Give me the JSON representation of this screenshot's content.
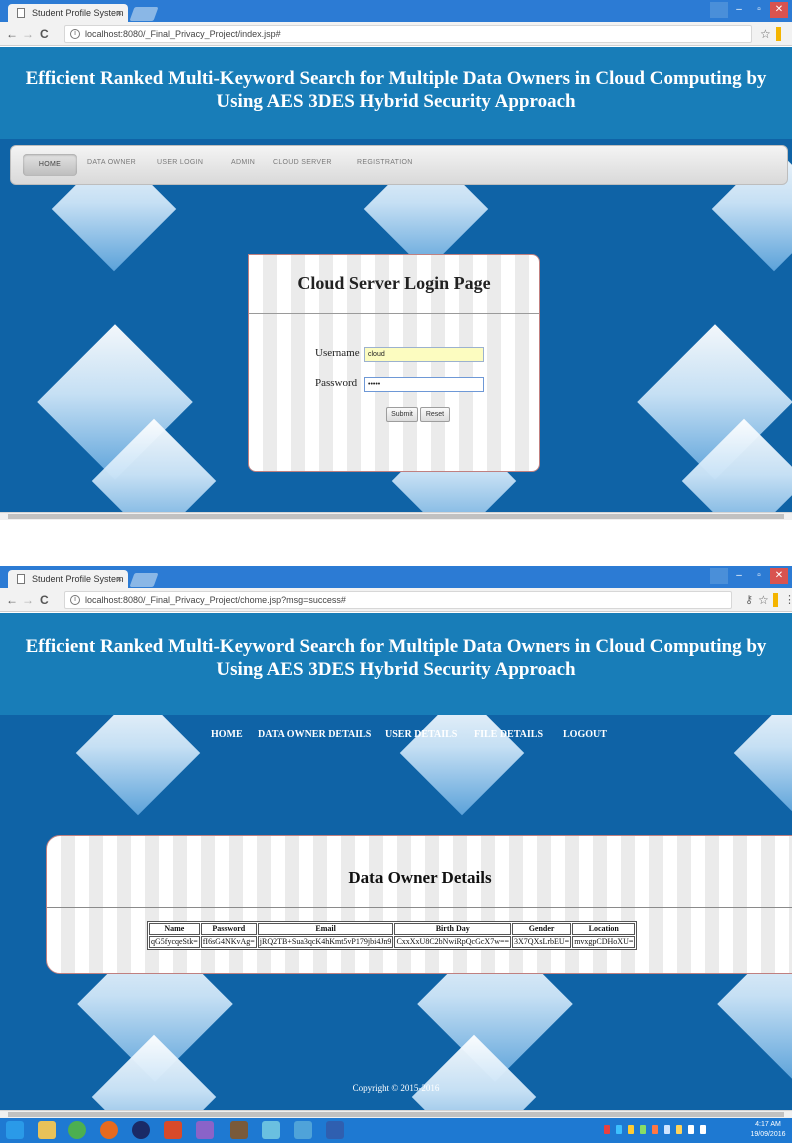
{
  "screenshot1": {
    "browser": {
      "tab_title": "Student Profile System",
      "tab_close": "×",
      "back": "←",
      "forward": "→",
      "reload": "C",
      "url": "localhost:8080/_Final_Privacy_Project/index.jsp#",
      "star": "☆"
    },
    "header": {
      "title": "Efficient Ranked Multi-Keyword Search for Multiple Data Owners in Cloud Computing by Using AES 3DES Hybrid Security Approach"
    },
    "menu": [
      "HOME",
      "DATA OWNER",
      "USER LOGIN",
      "ADMIN",
      "CLOUD SERVER",
      "REGISTRATION"
    ],
    "login": {
      "heading": "Cloud Server Login Page",
      "username_label": "Username",
      "username_value": "cloud",
      "password_label": "Password",
      "password_value": "•••••",
      "submit_label": "Submit",
      "reset_label": "Reset"
    }
  },
  "screenshot2": {
    "browser": {
      "tab_title": "Student Profile System",
      "tab_close": "×",
      "back": "←",
      "forward": "→",
      "reload": "C",
      "url": "localhost:8080/_Final_Privacy_Project/chome.jsp?msg=success#",
      "star": "☆"
    },
    "header": {
      "title": "Efficient Ranked Multi-Keyword Search for Multiple Data Owners in Cloud Computing by Using AES 3DES Hybrid Security Approach"
    },
    "menu": [
      "HOME",
      "DATA OWNER DETAILS",
      "USER DETAILS",
      "FILE DETAILS",
      "LOGOUT"
    ],
    "panel": {
      "heading": "Data Owner Details",
      "columns": [
        "Name",
        "Password",
        "Email",
        "Birth Day",
        "Gender",
        "Location"
      ],
      "row": [
        "qG5fycqeStk=",
        "fI6sG4NKvAg=",
        "jRQ2TB+Sua3qcK4hKmt5vP179jbi4Jn9",
        "CxxXxU8C2bNwiRpQcGcX7w==",
        "3X7QXsLrbEU=",
        "mvxgpCDHoXU="
      ]
    },
    "copyright": "Copyright © 2015-2016",
    "taskbar": {
      "time": "4:17 AM",
      "date": "19/09/2016",
      "colors": {
        "taskbar": "#1e79d2",
        "page_bg": "#0f63a6",
        "header_bg": "#187db8",
        "panel_border": "#c08080"
      }
    }
  }
}
